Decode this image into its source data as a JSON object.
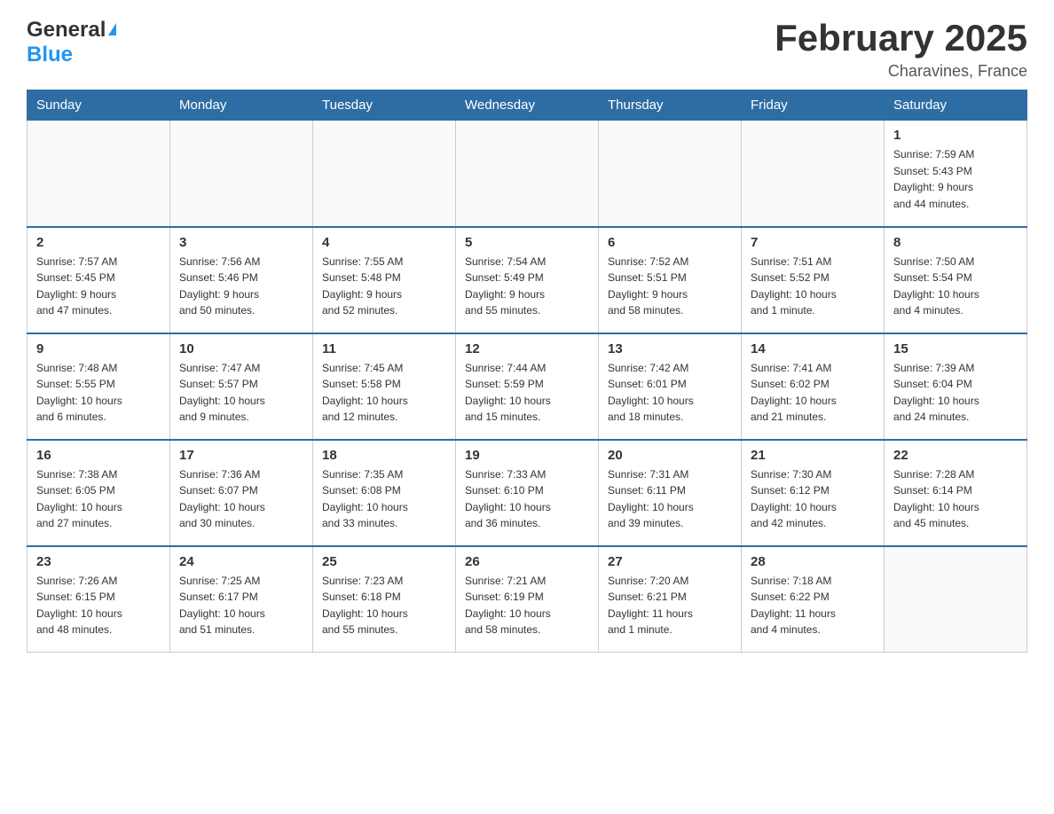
{
  "header": {
    "logo_general": "General",
    "logo_blue": "Blue",
    "month_title": "February 2025",
    "location": "Charavines, France"
  },
  "weekdays": [
    "Sunday",
    "Monday",
    "Tuesday",
    "Wednesday",
    "Thursday",
    "Friday",
    "Saturday"
  ],
  "weeks": [
    [
      {
        "num": "",
        "info": ""
      },
      {
        "num": "",
        "info": ""
      },
      {
        "num": "",
        "info": ""
      },
      {
        "num": "",
        "info": ""
      },
      {
        "num": "",
        "info": ""
      },
      {
        "num": "",
        "info": ""
      },
      {
        "num": "1",
        "info": "Sunrise: 7:59 AM\nSunset: 5:43 PM\nDaylight: 9 hours\nand 44 minutes."
      }
    ],
    [
      {
        "num": "2",
        "info": "Sunrise: 7:57 AM\nSunset: 5:45 PM\nDaylight: 9 hours\nand 47 minutes."
      },
      {
        "num": "3",
        "info": "Sunrise: 7:56 AM\nSunset: 5:46 PM\nDaylight: 9 hours\nand 50 minutes."
      },
      {
        "num": "4",
        "info": "Sunrise: 7:55 AM\nSunset: 5:48 PM\nDaylight: 9 hours\nand 52 minutes."
      },
      {
        "num": "5",
        "info": "Sunrise: 7:54 AM\nSunset: 5:49 PM\nDaylight: 9 hours\nand 55 minutes."
      },
      {
        "num": "6",
        "info": "Sunrise: 7:52 AM\nSunset: 5:51 PM\nDaylight: 9 hours\nand 58 minutes."
      },
      {
        "num": "7",
        "info": "Sunrise: 7:51 AM\nSunset: 5:52 PM\nDaylight: 10 hours\nand 1 minute."
      },
      {
        "num": "8",
        "info": "Sunrise: 7:50 AM\nSunset: 5:54 PM\nDaylight: 10 hours\nand 4 minutes."
      }
    ],
    [
      {
        "num": "9",
        "info": "Sunrise: 7:48 AM\nSunset: 5:55 PM\nDaylight: 10 hours\nand 6 minutes."
      },
      {
        "num": "10",
        "info": "Sunrise: 7:47 AM\nSunset: 5:57 PM\nDaylight: 10 hours\nand 9 minutes."
      },
      {
        "num": "11",
        "info": "Sunrise: 7:45 AM\nSunset: 5:58 PM\nDaylight: 10 hours\nand 12 minutes."
      },
      {
        "num": "12",
        "info": "Sunrise: 7:44 AM\nSunset: 5:59 PM\nDaylight: 10 hours\nand 15 minutes."
      },
      {
        "num": "13",
        "info": "Sunrise: 7:42 AM\nSunset: 6:01 PM\nDaylight: 10 hours\nand 18 minutes."
      },
      {
        "num": "14",
        "info": "Sunrise: 7:41 AM\nSunset: 6:02 PM\nDaylight: 10 hours\nand 21 minutes."
      },
      {
        "num": "15",
        "info": "Sunrise: 7:39 AM\nSunset: 6:04 PM\nDaylight: 10 hours\nand 24 minutes."
      }
    ],
    [
      {
        "num": "16",
        "info": "Sunrise: 7:38 AM\nSunset: 6:05 PM\nDaylight: 10 hours\nand 27 minutes."
      },
      {
        "num": "17",
        "info": "Sunrise: 7:36 AM\nSunset: 6:07 PM\nDaylight: 10 hours\nand 30 minutes."
      },
      {
        "num": "18",
        "info": "Sunrise: 7:35 AM\nSunset: 6:08 PM\nDaylight: 10 hours\nand 33 minutes."
      },
      {
        "num": "19",
        "info": "Sunrise: 7:33 AM\nSunset: 6:10 PM\nDaylight: 10 hours\nand 36 minutes."
      },
      {
        "num": "20",
        "info": "Sunrise: 7:31 AM\nSunset: 6:11 PM\nDaylight: 10 hours\nand 39 minutes."
      },
      {
        "num": "21",
        "info": "Sunrise: 7:30 AM\nSunset: 6:12 PM\nDaylight: 10 hours\nand 42 minutes."
      },
      {
        "num": "22",
        "info": "Sunrise: 7:28 AM\nSunset: 6:14 PM\nDaylight: 10 hours\nand 45 minutes."
      }
    ],
    [
      {
        "num": "23",
        "info": "Sunrise: 7:26 AM\nSunset: 6:15 PM\nDaylight: 10 hours\nand 48 minutes."
      },
      {
        "num": "24",
        "info": "Sunrise: 7:25 AM\nSunset: 6:17 PM\nDaylight: 10 hours\nand 51 minutes."
      },
      {
        "num": "25",
        "info": "Sunrise: 7:23 AM\nSunset: 6:18 PM\nDaylight: 10 hours\nand 55 minutes."
      },
      {
        "num": "26",
        "info": "Sunrise: 7:21 AM\nSunset: 6:19 PM\nDaylight: 10 hours\nand 58 minutes."
      },
      {
        "num": "27",
        "info": "Sunrise: 7:20 AM\nSunset: 6:21 PM\nDaylight: 11 hours\nand 1 minute."
      },
      {
        "num": "28",
        "info": "Sunrise: 7:18 AM\nSunset: 6:22 PM\nDaylight: 11 hours\nand 4 minutes."
      },
      {
        "num": "",
        "info": ""
      }
    ]
  ]
}
